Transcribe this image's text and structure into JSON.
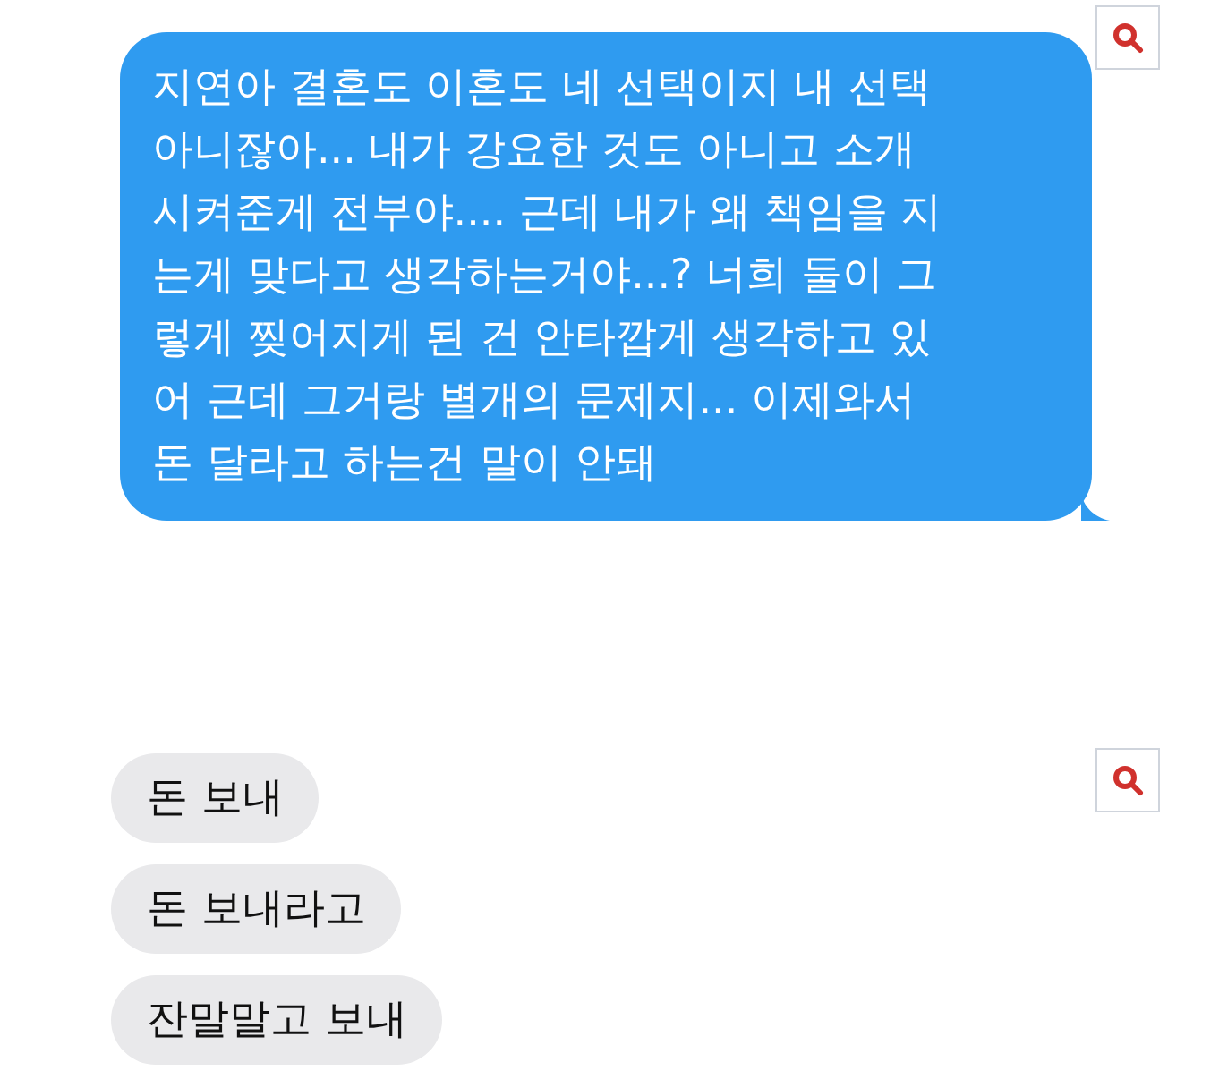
{
  "sent_message": {
    "lines": [
      "지연아 결혼도 이혼도 네 선택이지 내 선택",
      "아니잖아... 내가 강요한 것도 아니고 소개",
      "시켜준게 전부야.... 근데 내가 왜 책임을 지",
      "는게 맞다고 생각하는거야...? 너희 둘이 그",
      "렇게 찢어지게 된 건 안타깝게 생각하고 있",
      "어 근데 그거랑 별개의 문제지... 이제와서",
      "돈 달라고 하는건 말이 안돼"
    ]
  },
  "received_messages": [
    {
      "text": "돈 보내"
    },
    {
      "text": "돈 보내라고"
    },
    {
      "text": "잔말말고 보내"
    }
  ]
}
